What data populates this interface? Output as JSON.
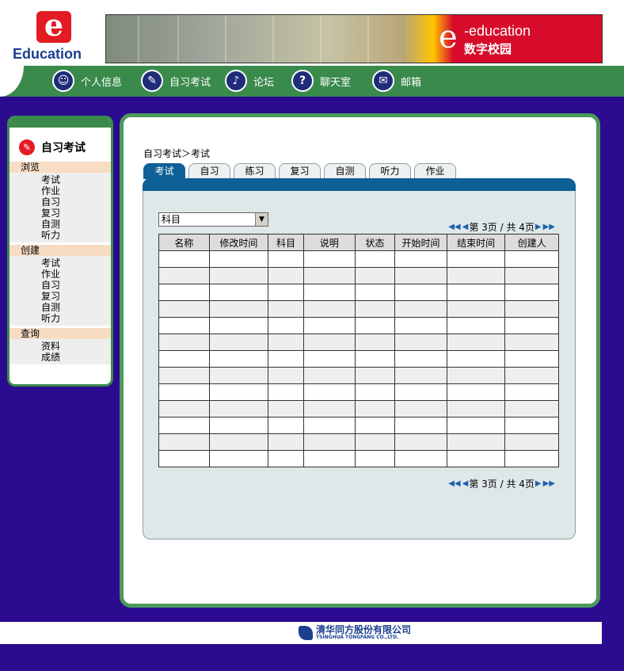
{
  "header": {
    "logo_letter": "e",
    "logo_text": "Education",
    "banner_e": "e",
    "banner_line1": "-education",
    "banner_line2": "数字校园"
  },
  "nav": {
    "items": [
      {
        "label": "个人信息",
        "icon": "person-icon"
      },
      {
        "label": "自习考试",
        "icon": "exam-icon"
      },
      {
        "label": "论坛",
        "icon": "microphone-icon"
      },
      {
        "label": "聊天室",
        "icon": "chat-icon"
      },
      {
        "label": "邮箱",
        "icon": "mail-icon"
      }
    ]
  },
  "sidebar": {
    "title": "自习考试",
    "sections": [
      {
        "head": "浏览",
        "items": [
          "考试",
          "作业",
          "自习",
          "复习",
          "自测",
          "听力"
        ]
      },
      {
        "head": "创建",
        "items": [
          "考试",
          "作业",
          "自习",
          "复习",
          "自测",
          "听力"
        ]
      },
      {
        "head": "查询",
        "items": [
          "资料",
          "成绩"
        ]
      }
    ]
  },
  "main": {
    "breadcrumb": "自习考试＞考试",
    "tabs": [
      "考试",
      "自习",
      "练习",
      "复习",
      "自测",
      "听力",
      "作业"
    ],
    "active_tab": 0,
    "subject_select": "科目",
    "pager_text": "第 3页 / 共 4页",
    "columns": [
      "名称",
      "修改时间",
      "科目",
      "说明",
      "状态",
      "开始时间",
      "结束时间",
      "创建人"
    ],
    "row_count": 13
  },
  "footer": {
    "company_cn": "清华同方股份有限公司",
    "company_en": "TSINGHUA TONGFANG CO.,LTD."
  },
  "colors": {
    "background": "#2b0b8f",
    "green": "#3a8a4c",
    "tab_active": "#0e6096",
    "brand_red": "#e31b23"
  }
}
